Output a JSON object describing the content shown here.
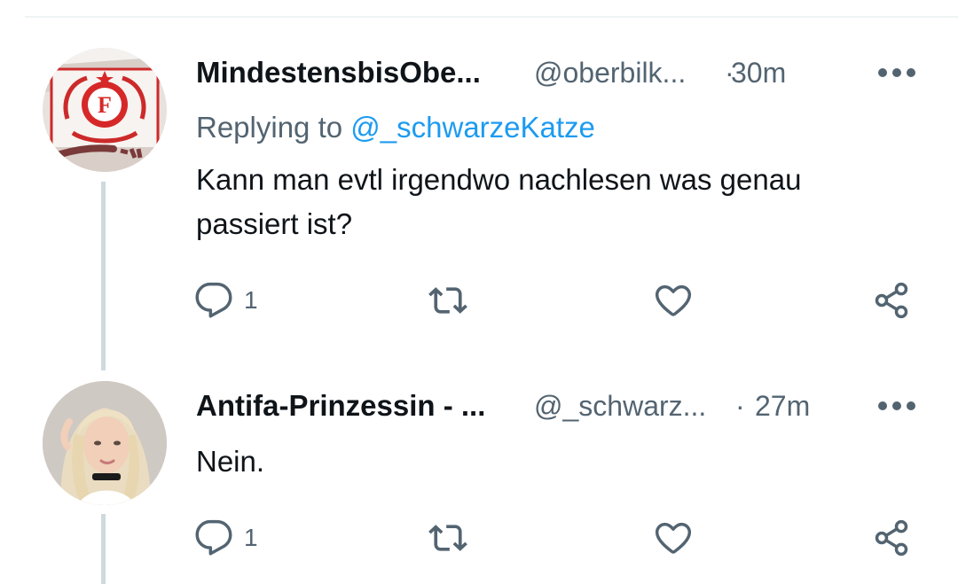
{
  "tweets": [
    {
      "name": "MindestensbisObe...",
      "handle": "@oberbilk...",
      "separator": "·",
      "time": "30m",
      "replying_prefix": "Replying to",
      "replying_handle": "@_schwarzeKatze",
      "text": "Kann man evtl irgendwo nachlesen was genau passiert ist?",
      "reply_count": "1"
    },
    {
      "name": "Antifa-Prinzessin - ...",
      "handle": "@_schwarz...",
      "separator": "·",
      "time": "27m",
      "text": "Nein.",
      "reply_count": "1"
    }
  ],
  "colors": {
    "text_primary": "#0f1419",
    "text_secondary": "#536471",
    "accent": "#1d9bf0",
    "thread_line": "#cfd9de"
  },
  "icons": [
    "reply-icon",
    "retweet-icon",
    "like-icon",
    "share-icon",
    "more-icon"
  ]
}
